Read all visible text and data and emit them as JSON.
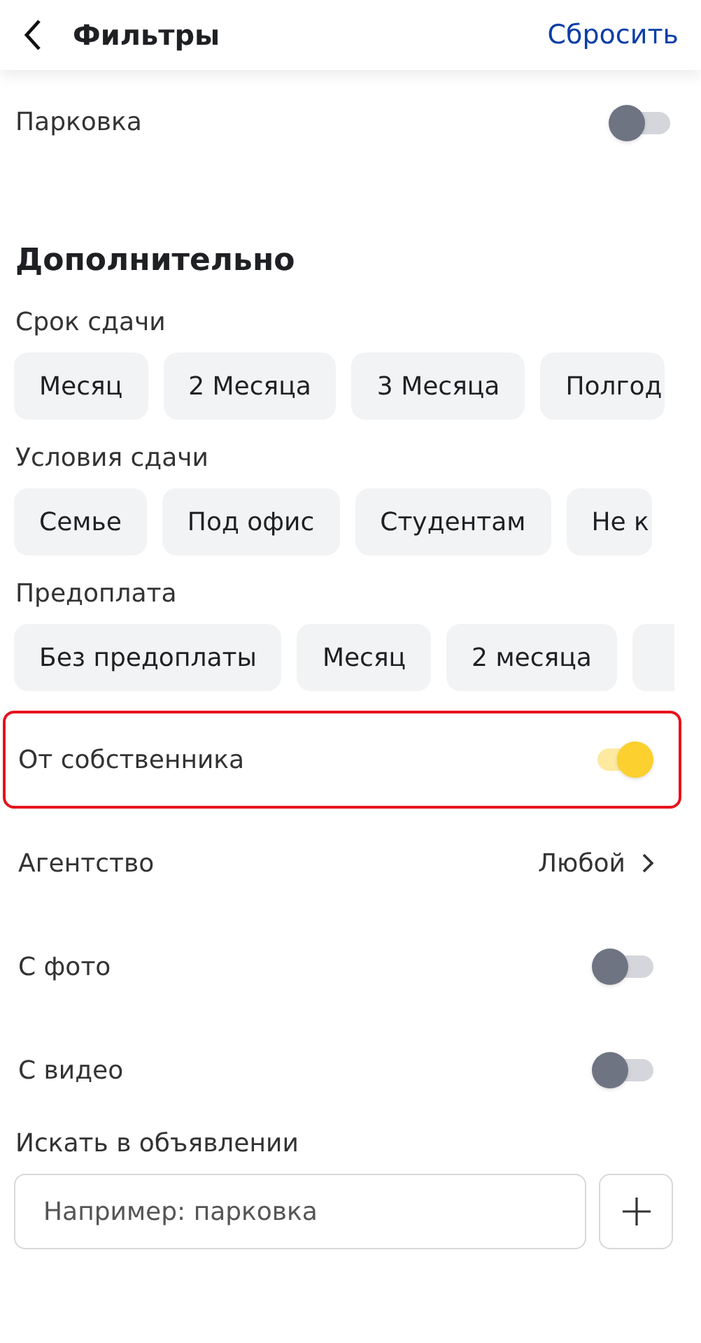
{
  "header": {
    "title": "Фильтры",
    "reset": "Сбросить"
  },
  "top_toggle": {
    "label": "Парковка",
    "on": false
  },
  "section_title": "Дополнительно",
  "chip_groups": [
    {
      "label": "Срок сдачи",
      "chips": [
        {
          "text": "Месяц",
          "selected": false
        },
        {
          "text": "2 Месяца",
          "selected": false
        },
        {
          "text": "3 Месяца",
          "selected": false
        },
        {
          "text": "Полгод",
          "selected": false,
          "cut": true
        }
      ],
      "more": false
    },
    {
      "label": "Условия сдачи",
      "chips": [
        {
          "text": "Семье",
          "selected": false
        },
        {
          "text": "Под офис",
          "selected": false
        },
        {
          "text": "Студентам",
          "selected": false
        },
        {
          "text": "Не к",
          "selected": false,
          "cut": true
        }
      ],
      "more": false
    },
    {
      "label": "Предоплата",
      "chips": [
        {
          "text": "Без предоплаты",
          "selected": false
        },
        {
          "text": "Месяц",
          "selected": false
        },
        {
          "text": "2 месяца",
          "selected": false
        }
      ],
      "more": true
    }
  ],
  "rows": [
    {
      "kind": "toggle",
      "label": "От собственника",
      "on": true,
      "highlighted": true
    },
    {
      "kind": "link",
      "label": "Агентство",
      "value": "Любой",
      "highlighted": false
    },
    {
      "kind": "toggle",
      "label": "С фото",
      "on": false,
      "highlighted": false
    },
    {
      "kind": "toggle",
      "label": "С видео",
      "on": false,
      "highlighted": false
    }
  ],
  "search": {
    "label": "Искать в объявлении",
    "placeholder": "Например: парковка"
  }
}
